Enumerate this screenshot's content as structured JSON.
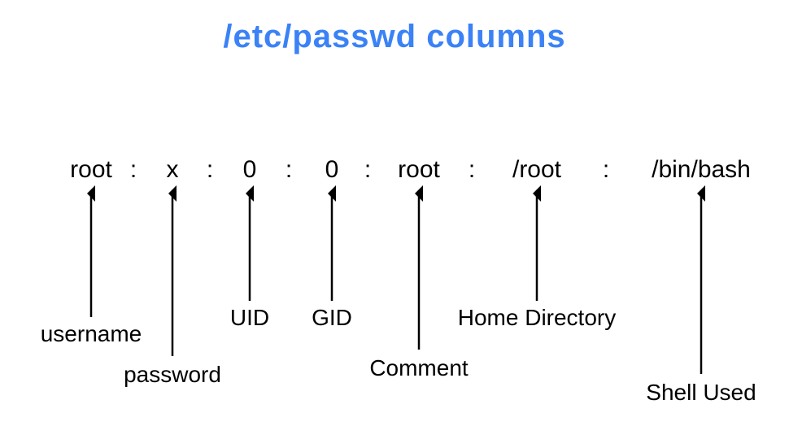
{
  "title": "/etc/passwd columns",
  "fields": {
    "username": "root",
    "password": "x",
    "uid": "0",
    "gid": "0",
    "comment": "root",
    "home": "/root",
    "shell": "/bin/bash"
  },
  "labels": {
    "username": "username",
    "password": "password",
    "uid": "UID",
    "gid": "GID",
    "comment": "Comment",
    "home": "Home Directory",
    "shell": "Shell Used"
  },
  "sep": ":"
}
